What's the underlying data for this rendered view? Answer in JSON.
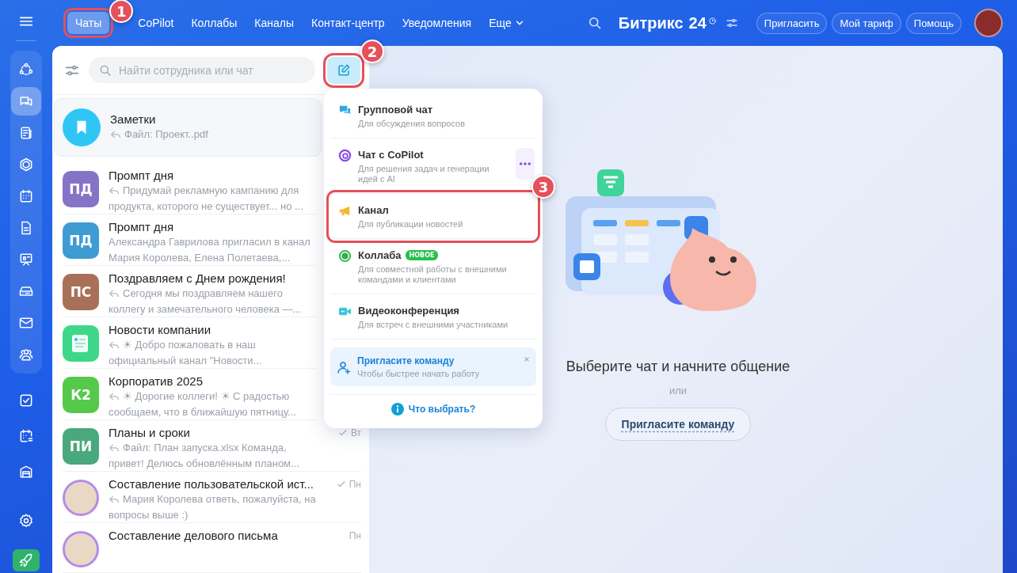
{
  "sidebar": {
    "menu_icon": true,
    "pinned_items": [
      {
        "kind": "feed",
        "selected": false
      },
      {
        "kind": "chat",
        "selected": true
      },
      {
        "kind": "news",
        "selected": false
      },
      {
        "kind": "hexagon",
        "selected": false
      },
      {
        "kind": "calendar",
        "selected": false
      },
      {
        "kind": "document",
        "selected": false
      },
      {
        "kind": "presentation",
        "selected": false
      },
      {
        "kind": "drive",
        "selected": false
      },
      {
        "kind": "mail",
        "selected": false
      },
      {
        "kind": "people",
        "selected": false
      }
    ],
    "items": [
      {
        "kind": "task",
        "selected": false
      },
      {
        "kind": "schedule",
        "selected": false
      },
      {
        "kind": "store",
        "selected": false
      }
    ],
    "bottom_items": [
      {
        "kind": "settings",
        "selected": false
      },
      {
        "kind": "rocket",
        "selected": false
      }
    ]
  },
  "tabs": [
    {
      "label": "Чаты",
      "selected": true,
      "callout": "1"
    },
    {
      "label": "CoPilot",
      "selected": false
    },
    {
      "label": "Коллабы",
      "selected": false
    },
    {
      "label": "Каналы",
      "selected": false
    },
    {
      "label": "Контакт-центр",
      "selected": false
    },
    {
      "label": "Уведомления",
      "selected": false
    },
    {
      "label": "Еще",
      "selected": false,
      "dropdown": true
    }
  ],
  "header": {
    "logo": "Битрикс",
    "logo_number": "24",
    "buttons": [
      "Пригласить",
      "Мой тариф",
      "Помощь"
    ]
  },
  "chat_list": {
    "search": {
      "placeholder": "Найти сотрудника или чат"
    },
    "compose_button": {
      "callout": "2"
    },
    "chats": [
      {
        "title": "Заметки",
        "preview": "Файл: Проект..pdf",
        "reply": true,
        "avatar": {
          "kind": "bookmark",
          "color": "#2fc6f6"
        },
        "pinned": true
      },
      {
        "title": "Промпт дня",
        "preview": "Придумай рекламную кампанию для продукта, которого не существует... но ...",
        "reply": true,
        "avatar": {
          "kind": "initials",
          "initials": "ПД",
          "color": "#8474c8"
        }
      },
      {
        "title": "Промпт дня",
        "preview": "Александра Гаврилова пригласил в канал Мария Королева, Елена Полетаева,...",
        "avatar": {
          "kind": "initials",
          "initials": "ПД",
          "color": "#3f9bd4"
        }
      },
      {
        "title": "Поздравляем с Днем рождения!",
        "preview": "Сегодня мы поздравляем нашего коллегу и замечательного человека —...",
        "reply": true,
        "avatar": {
          "kind": "initials",
          "initials": "ПС",
          "color": "#a87058"
        }
      },
      {
        "title": "Новости компании",
        "preview": "☀ Добро пожаловать в наш официальный канал \"Новости...",
        "reply": true,
        "avatar": {
          "kind": "news",
          "color": "#3ed78a"
        }
      },
      {
        "title": "Корпоратив 2025",
        "preview": "☀ Дорогие коллеги! ☀ С радостью сообщаем, что в ближайшую пятницу...",
        "reply": true,
        "avatar": {
          "kind": "initials",
          "initials": "К2",
          "color": "#55c94a"
        }
      },
      {
        "title": "Планы и сроки",
        "preview": "Файл: План запуска.xlsx Команда, привет! Делюсь обновлённым планом...",
        "reply": true,
        "time": "Вт",
        "read": true,
        "avatar": {
          "kind": "initials",
          "initials": "ПИ",
          "color": "#4aa87e"
        }
      },
      {
        "title": "Составление пользовательской ист...",
        "preview": "Мария Королева ответь, пожалуйста, на вопросы выше :)",
        "reply": true,
        "time": "Пн",
        "read": true,
        "avatar": {
          "kind": "photo",
          "color": "#b48be8"
        }
      },
      {
        "title": "Составление делового письма",
        "time": "Пн",
        "read": false,
        "avatar": {
          "kind": "photo",
          "color": "#b48be8"
        }
      }
    ]
  },
  "create_menu": {
    "items": [
      {
        "kind": "group-chat",
        "title": "Групповой чат",
        "subtitle": "Для обсуждения вопросов"
      },
      {
        "kind": "copilot",
        "title": "Чат с CoPilot",
        "subtitle": "Для решения задач и генерации идей с AI",
        "more_button": true
      },
      {
        "kind": "channel",
        "title": "Канал",
        "subtitle": "Для публикации новостей",
        "callout": "3"
      },
      {
        "kind": "collab",
        "title": "Коллаба",
        "badge": "НОВОЕ",
        "subtitle": "Для совместной работы с внешними командами и клиентами"
      },
      {
        "kind": "video",
        "title": "Видеоконференция",
        "subtitle": "Для встреч с внешними участниками"
      }
    ],
    "invite": {
      "title": "Пригласите команду",
      "subtitle": "Чтобы быстрее начать работу"
    },
    "help_link": "Что выбрать?"
  },
  "empty_state": {
    "title": "Выберите чат и начните общение",
    "separator": "или",
    "button": "Пригласите команду"
  }
}
